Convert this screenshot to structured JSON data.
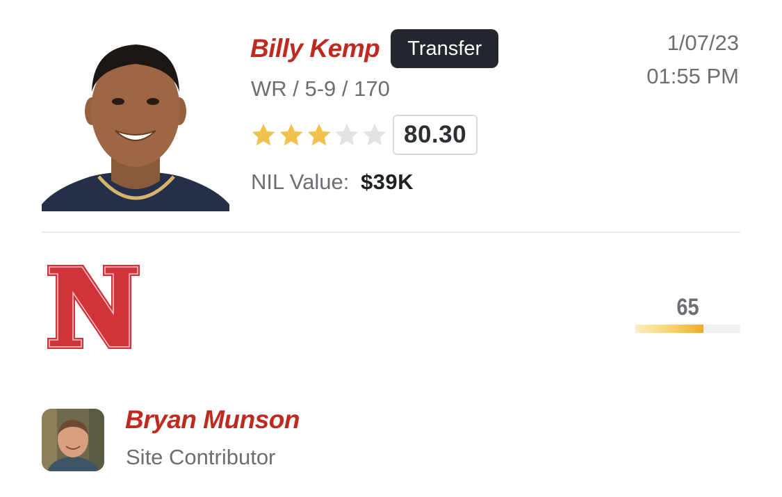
{
  "player": {
    "name": "Billy Kemp",
    "badge": "Transfer",
    "position_height_weight": "WR / 5-9 / 170",
    "stars": {
      "filled": 3,
      "total": 5
    },
    "rating": "80.30",
    "nil_label": "NIL Value:",
    "nil_value": "$39K",
    "photo_icon": "player-headshot"
  },
  "timestamp": {
    "date": "1/07/23",
    "time": "01:55 PM"
  },
  "school": {
    "logo_icon": "nebraska-n-logo",
    "score": "65",
    "score_fill_fraction": 0.65
  },
  "author": {
    "name": "Bryan Munson",
    "role": "Site Contributor",
    "avatar_icon": "author-avatar"
  },
  "colors": {
    "accent_red": "#bf2a20",
    "badge_bg": "#22272d",
    "star_filled": "#f0c24b",
    "star_empty": "#e3e3e3",
    "muted_text": "#6b6e72",
    "logo_red": "#d0343a"
  }
}
